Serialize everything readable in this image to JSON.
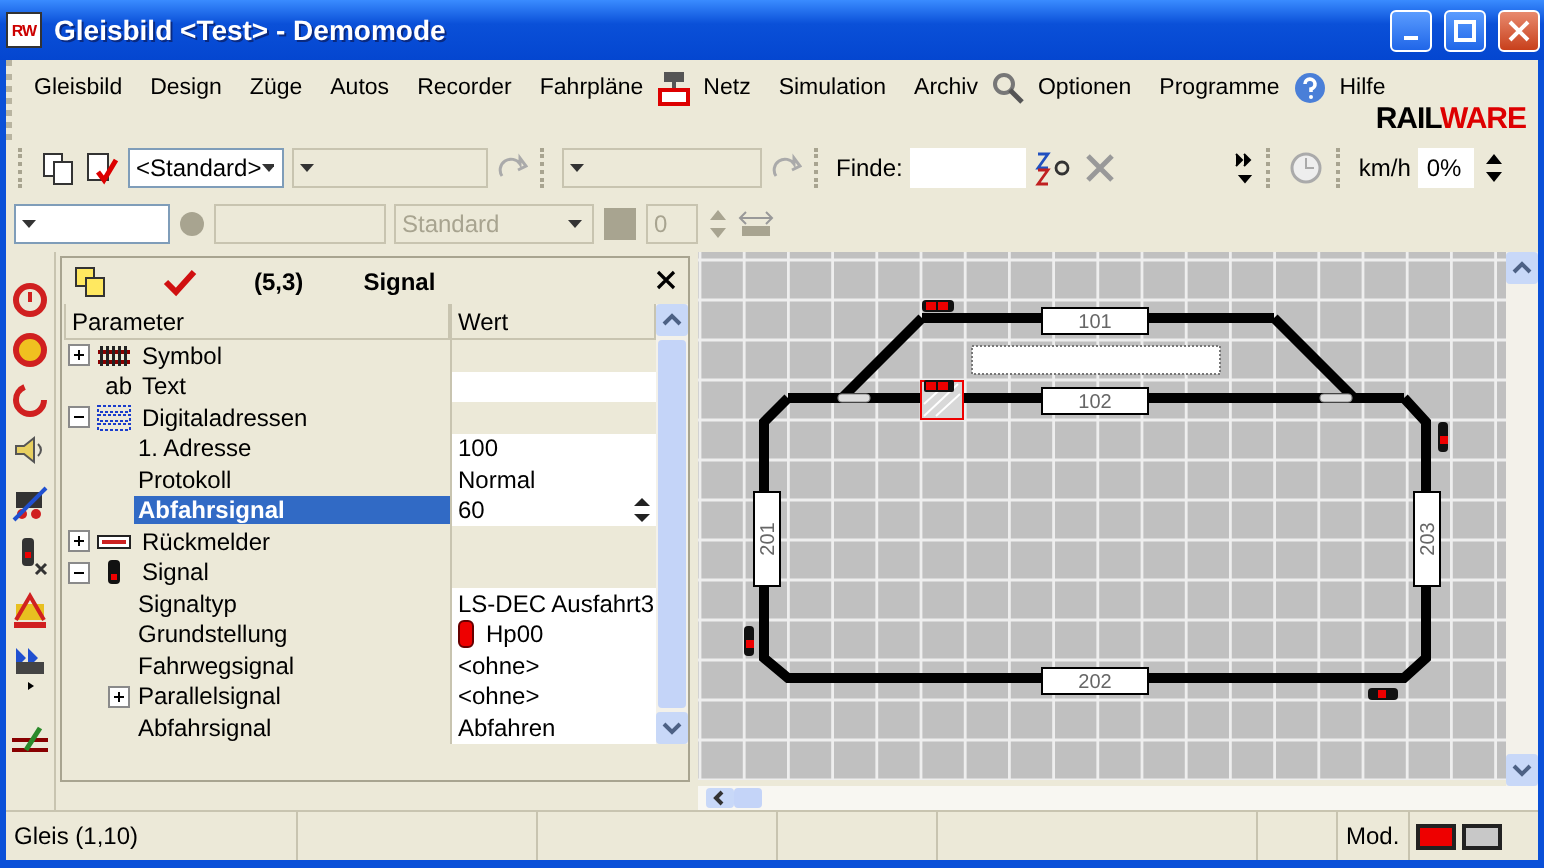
{
  "window": {
    "app_icon": "RW",
    "title": "Gleisbild <Test> - Demomode"
  },
  "menu": [
    {
      "label": "Gleisbild"
    },
    {
      "label": "Design"
    },
    {
      "label": "Züge"
    },
    {
      "label": "Autos"
    },
    {
      "label": "Recorder"
    },
    {
      "label": "Fahrpläne"
    },
    {
      "label": "Netz"
    },
    {
      "label": "Simulation"
    },
    {
      "label": "Archiv"
    },
    {
      "label": "Optionen"
    },
    {
      "label": "Programme"
    },
    {
      "label": "Hilfe"
    }
  ],
  "logo": {
    "part_1": "RAIL",
    "part_2": "WARE"
  },
  "toolbar": {
    "style_select": {
      "value": "<Standard>",
      "disabled": false
    },
    "select_2": {
      "disabled": true
    },
    "select_3": {
      "disabled": true
    },
    "find": {
      "label": "Finde:"
    },
    "speed": {
      "unit": "km/h",
      "value": "0%"
    },
    "select_4": {
      "disabled": false
    },
    "line_style_select": {
      "value": "Standard",
      "disabled": true
    },
    "number_field": {
      "value": "0",
      "disabled": true
    }
  },
  "properties": {
    "position": "(5,3)",
    "title": "Signal",
    "columns": [
      "Parameter",
      "Wert"
    ],
    "rows": [
      {
        "label": "Symbol",
        "kind": "track",
        "expanded": false,
        "selected": false
      },
      {
        "label": "Text",
        "kind": "text",
        "icon_text": "ab",
        "selected": false
      },
      {
        "label": "Digitaladressen",
        "kind": "binary",
        "expanded": true,
        "selected": false,
        "children": [
          {
            "label": "1. Adresse",
            "kind": "value",
            "value": "100",
            "selected": false
          },
          {
            "label": "Protokoll",
            "kind": "value",
            "value": "Normal",
            "selected": false
          },
          {
            "label": "Abfahrsignal",
            "kind": "spin",
            "value": "60",
            "selected": true
          }
        ]
      },
      {
        "label": "Rückmelder",
        "kind": "sensor",
        "expanded": false,
        "selected": false
      },
      {
        "label": "Signal",
        "kind": "signal",
        "expanded": true,
        "selected": false,
        "children": [
          {
            "label": "Signaltyp",
            "kind": "value",
            "value": "LS-DEC Ausfahrt3",
            "selected": false
          },
          {
            "label": "Grundstellung",
            "kind": "aspect",
            "value": "Hp00",
            "selected": false
          },
          {
            "label": "Fahrwegsignal",
            "kind": "value",
            "value": "<ohne>",
            "selected": false
          },
          {
            "label": "Parallelsignal",
            "kind": "value",
            "value": "<ohne>",
            "expanded": false,
            "selected": false
          },
          {
            "label": "Abfahrsignal",
            "kind": "value",
            "value": "Abfahren",
            "selected": false
          }
        ]
      }
    ]
  },
  "track_plan": {
    "blocks": [
      {
        "label": "101"
      },
      {
        "label": "102"
      },
      {
        "label": "201"
      },
      {
        "label": "202"
      },
      {
        "label": "203"
      }
    ]
  },
  "status_bar": {
    "text": "Gleis (1,10)",
    "mode_label": "Mod."
  }
}
